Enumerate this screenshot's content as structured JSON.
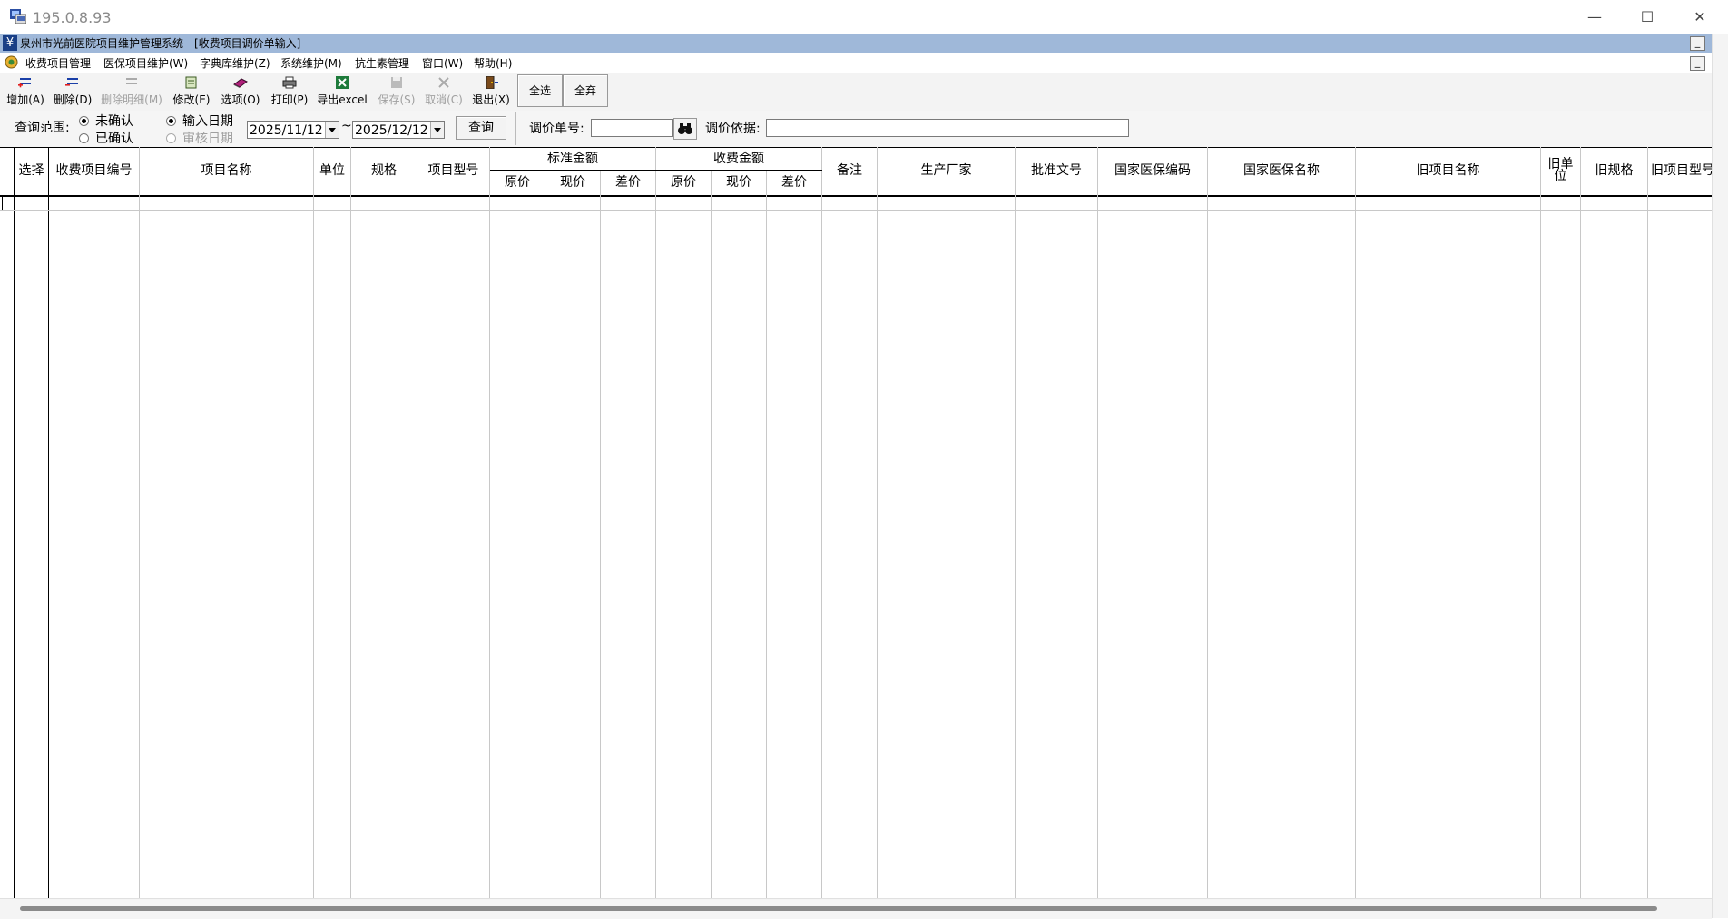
{
  "window": {
    "title": "195.0.8.93"
  },
  "mdi": {
    "caption": "泉州市光前医院项目维护管理系统 - [收费项目调价单输入]"
  },
  "menu": [
    "收费项目管理",
    "医保项目维护(W)",
    "字典库维护(Z)",
    "系统维护(M)",
    "抗生素管理",
    "窗口(W)",
    "帮助(H)"
  ],
  "toolbar": {
    "add": "增加(A)",
    "delete": "删除(D)",
    "delete_detail": "删除明细(M)",
    "modify": "修改(E)",
    "options": "选项(O)",
    "print": "打印(P)",
    "export": "导出excel",
    "save": "保存(S)",
    "cancel": "取消(C)",
    "exit": "退出(X)",
    "select_all": "全选",
    "deselect_all": "全弃"
  },
  "query": {
    "range_label": "查询范围:",
    "unconfirmed": "未确认",
    "confirmed": "已确认",
    "input_date": "输入日期",
    "audit_date": "审核日期",
    "date_from": "2025/11/12",
    "date_sep": "~",
    "date_to": "2025/12/12",
    "search": "查询",
    "order_no_label": "调价单号:",
    "basis_label": "调价依据:",
    "order_no_value": "",
    "basis_value": ""
  },
  "columns": {
    "select": "选择",
    "code": "收费项目编号",
    "name": "项目名称",
    "unit": "单位",
    "spec": "规格",
    "model": "项目型号",
    "std_amount": "标准金额",
    "fee_amount": "收费金额",
    "orig_price": "原价",
    "cur_price": "现价",
    "diff": "差价",
    "remark": "备注",
    "maker": "生产厂家",
    "approval": "批准文号",
    "nhsa_code": "国家医保编码",
    "nhsa_name": "国家医保名称",
    "old_name": "旧项目名称",
    "old_unit": "旧单\n位",
    "old_spec": "旧规格",
    "old_model": "旧项目型号"
  },
  "colors": {
    "mdi_caption": "#9fb8d9",
    "yen_icon": "#1a3f86"
  }
}
